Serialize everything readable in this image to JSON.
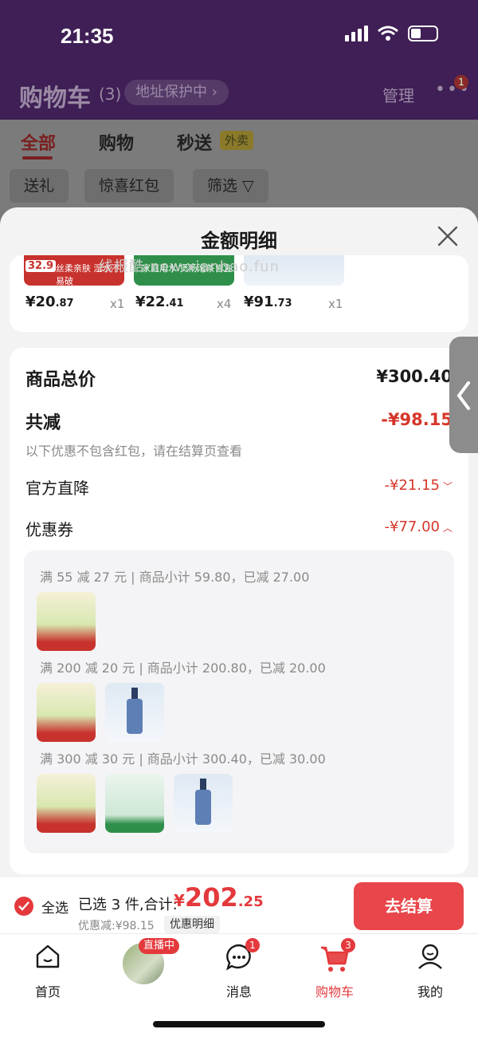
{
  "status": {
    "time": "21:35"
  },
  "header": {
    "title": "购物车",
    "count": "(3)",
    "address_chip": "地址保护中",
    "manage": "管理",
    "more_badge": "1"
  },
  "tabs": [
    {
      "label": "全部"
    },
    {
      "label": "购物"
    },
    {
      "label": "秒送",
      "badge": "外卖"
    }
  ],
  "chips": [
    {
      "label": "送礼"
    },
    {
      "label": "惊喜红包"
    },
    {
      "label": "筛选"
    }
  ],
  "sheet": {
    "title": "金额明细",
    "watermark": "线报酷-new.xianbao.fun",
    "items": [
      {
        "badge_price": "32.9",
        "tag": "丝柔亲肤 湿水不易破",
        "price_int": "¥20",
        "price_dec": ".87",
        "qty": "x1"
      },
      {
        "tag": "家庭用水 煲汤泡茶皆宜",
        "price_int": "¥22",
        "price_dec": ".41",
        "qty": "x4"
      },
      {
        "price_int": "¥91",
        "price_dec": ".73",
        "qty": "x1"
      }
    ],
    "summary": {
      "total_label": "商品总价",
      "total_value": "¥300.40",
      "reduce_label": "共减",
      "reduce_value": "-¥98.15",
      "note": "以下优惠不包含红包，请在结算页查看",
      "official_label": "官方直降",
      "official_value": "-¥21.15",
      "coupon_label": "优惠券",
      "coupon_value": "-¥77.00"
    },
    "coupons": [
      {
        "text": "满 55 减 27 元 | 商品小计 59.80，已减 27.00"
      },
      {
        "text": "满 200 减 20 元 | 商品小计 200.80，已减 20.00"
      },
      {
        "text": "满 300 减 30 元 | 商品小计 300.40，已减 30.00"
      }
    ]
  },
  "footer": {
    "select_all": "全选",
    "selected_text": "已选 3 件,合计:",
    "total_yen": "¥",
    "total_int": "202",
    "total_dec": ".25",
    "discount_text": "优惠减:¥98.15",
    "detail_button": "优惠明细",
    "checkout": "去结算"
  },
  "nav": [
    {
      "label": "首页",
      "icon": "home-icon"
    },
    {
      "label": "",
      "icon": "live-avatar",
      "badge": "直播中"
    },
    {
      "label": "消息",
      "icon": "message-icon",
      "badge": "1"
    },
    {
      "label": "购物车",
      "icon": "cart-icon",
      "badge": "3",
      "active": true
    },
    {
      "label": "我的",
      "icon": "profile-icon"
    }
  ],
  "colors": {
    "accent_red": "#e4393c",
    "header_purple": "#3f1f55"
  }
}
